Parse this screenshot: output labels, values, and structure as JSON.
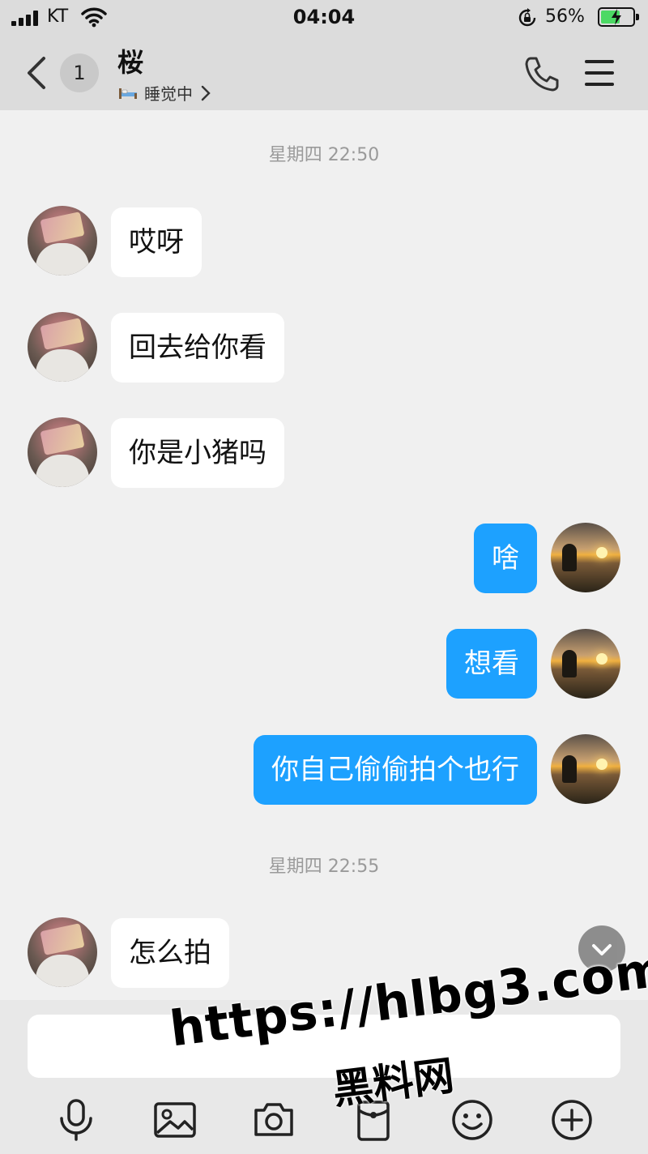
{
  "status_bar": {
    "carrier": "KT",
    "time": "04:04",
    "battery_percent": "56%",
    "battery_level": 0.56,
    "icons": [
      "signal-icon",
      "wifi-icon",
      "orientation-lock-icon",
      "battery-charging-icon"
    ]
  },
  "header": {
    "unread_count": "1",
    "contact_name": "桜",
    "contact_status": "睡觉中",
    "icons": [
      "back-icon",
      "bed-icon",
      "chevron-right-icon",
      "phone-icon",
      "menu-icon"
    ]
  },
  "messages": {
    "time_1": "星期四 22:50",
    "m1": "哎呀",
    "m2": "回去给你看",
    "m3": "你是小猪吗",
    "m4": "啥",
    "m5": "想看",
    "m6": "你自己偷偷拍个也行",
    "time_2": "星期四 22:55",
    "m7": "怎么拍"
  },
  "input": {
    "value": "",
    "toolbar_icons": [
      "microphone-icon",
      "image-icon",
      "camera-icon",
      "red-packet-icon",
      "emoji-icon",
      "plus-icon"
    ]
  },
  "watermark": {
    "url": "https://hlbg3.com",
    "site_name": "黑料网"
  },
  "colors": {
    "header_bg": "#dcdcdc",
    "chat_bg": "#f0f0f0",
    "my_bubble": "#1da1ff",
    "friend_bubble": "#ffffff",
    "battery_fill": "#4cd964"
  }
}
